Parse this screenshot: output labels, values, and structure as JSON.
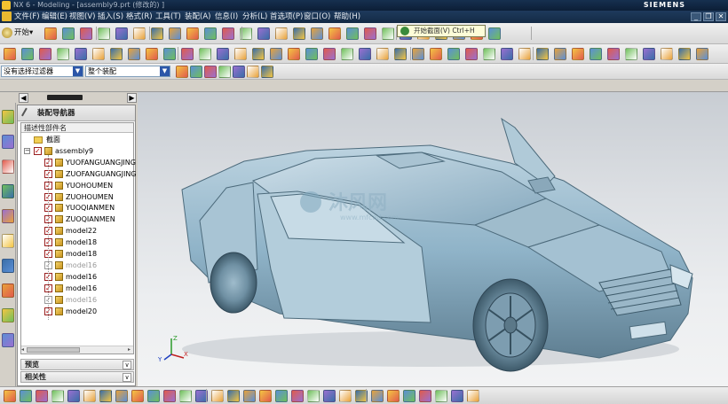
{
  "window": {
    "title": "NX 6 - Modeling - [assembly9.prt (修改的) ]",
    "brand": "SIEMENS",
    "min_label": "_",
    "restore_label": "❐",
    "close_label": "✕"
  },
  "menu": {
    "items": [
      "文件(F)",
      "编辑(E)",
      "视图(V)",
      "插入(S)",
      "格式(R)",
      "工具(T)",
      "装配(A)",
      "信息(I)",
      "分析(L)",
      "首选项(P)",
      "窗口(O)",
      "帮助(H)"
    ]
  },
  "toolbar": {
    "start_label": "开始▾",
    "tooltip": "开始截面(V)   Ctrl+H"
  },
  "filter": {
    "selection_filter": "没有选择过滤器",
    "scope": "整个装配"
  },
  "navigator": {
    "title": "装配导航器",
    "column_header": "描述性部件名",
    "items": [
      {
        "label": "截面",
        "kind": "folder",
        "level": 0
      },
      {
        "label": "assembly9",
        "kind": "root",
        "level": 0
      },
      {
        "label": "YUOFANGUANGJING",
        "kind": "part",
        "level": 1,
        "active": true
      },
      {
        "label": "ZUOFANGUANGJING",
        "kind": "part",
        "level": 1,
        "active": true
      },
      {
        "label": "YUOHOUMEN",
        "kind": "part",
        "level": 1,
        "active": true
      },
      {
        "label": "ZUOHOUMEN",
        "kind": "part",
        "level": 1,
        "active": true
      },
      {
        "label": "YUOQIANMEN",
        "kind": "part",
        "level": 1,
        "active": true
      },
      {
        "label": "ZUOQIANMEN",
        "kind": "part",
        "level": 1,
        "active": true
      },
      {
        "label": "model22",
        "kind": "part",
        "level": 1,
        "active": true
      },
      {
        "label": "model18",
        "kind": "part",
        "level": 1,
        "active": true
      },
      {
        "label": "model18",
        "kind": "part",
        "level": 1,
        "active": true
      },
      {
        "label": "model16",
        "kind": "part",
        "level": 1,
        "active": false
      },
      {
        "label": "model16",
        "kind": "part",
        "level": 1,
        "active": true
      },
      {
        "label": "model16",
        "kind": "part",
        "level": 1,
        "active": true
      },
      {
        "label": "model16",
        "kind": "part",
        "level": 1,
        "active": false
      },
      {
        "label": "model20",
        "kind": "part",
        "level": 1,
        "active": true
      }
    ],
    "sections": [
      "预览",
      "相关性"
    ]
  },
  "viewport": {
    "watermark_main": "沐风网",
    "watermark_url": "www.mfcad.com",
    "triad": {
      "x": "X",
      "y": "Y",
      "z": "Z"
    }
  },
  "colors": {
    "car_body": "#8fb3c8",
    "car_shadow": "#5f7f92",
    "title_bg": "#16304f"
  }
}
